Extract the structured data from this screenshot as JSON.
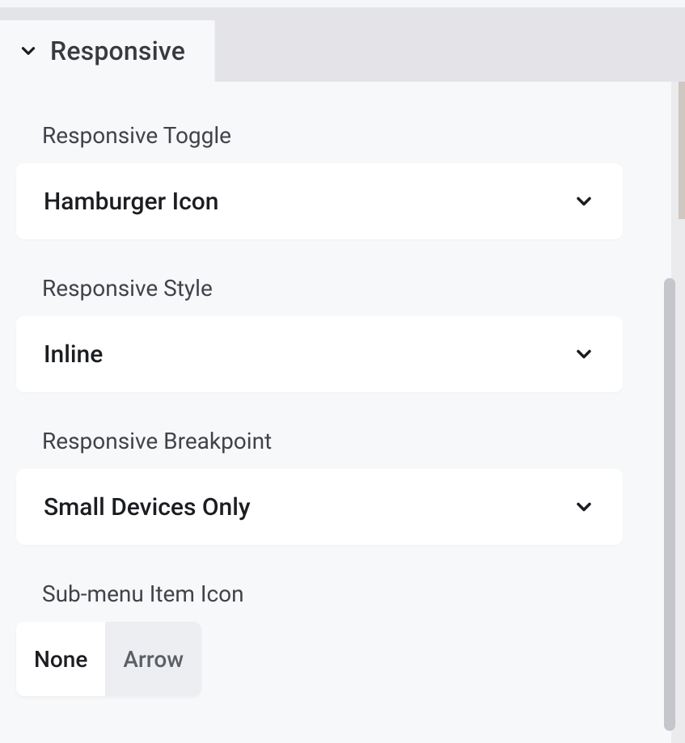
{
  "tab": {
    "title": "Responsive"
  },
  "fields": {
    "responsive_toggle": {
      "label": "Responsive Toggle",
      "value": "Hamburger Icon"
    },
    "responsive_style": {
      "label": "Responsive Style",
      "value": "Inline"
    },
    "responsive_breakpoint": {
      "label": "Responsive Breakpoint",
      "value": "Small Devices Only"
    },
    "submenu_item_icon": {
      "label": "Sub-menu Item Icon",
      "options": [
        "None",
        "Arrow"
      ],
      "selected_index": 0
    }
  }
}
